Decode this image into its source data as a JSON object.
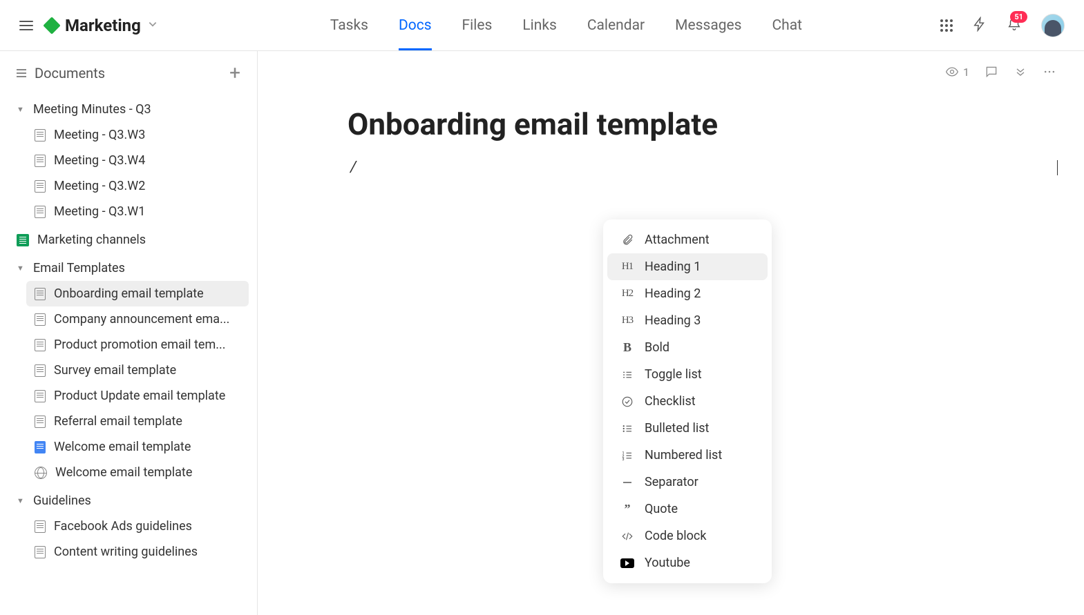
{
  "header": {
    "workspace_name": "Marketing",
    "tabs": [
      "Tasks",
      "Docs",
      "Files",
      "Links",
      "Calendar",
      "Messages",
      "Chat"
    ],
    "active_tab": 1,
    "notification_count": "51"
  },
  "sidebar": {
    "title": "Documents",
    "sections": [
      {
        "label": "Meeting Minutes - Q3",
        "expanded": true,
        "items": [
          {
            "label": "Meeting - Q3.W3",
            "type": "doc"
          },
          {
            "label": "Meeting - Q3.W4",
            "type": "doc"
          },
          {
            "label": "Meeting - Q3.W2",
            "type": "doc"
          },
          {
            "label": "Meeting - Q3.W1",
            "type": "doc"
          }
        ]
      },
      {
        "label": "Marketing channels",
        "expanded": false,
        "icon": "sheet"
      },
      {
        "label": "Email Templates",
        "expanded": true,
        "items": [
          {
            "label": "Onboarding email template",
            "type": "doc",
            "selected": true
          },
          {
            "label": "Company announcement ema...",
            "type": "doc"
          },
          {
            "label": "Product promotion email tem...",
            "type": "doc"
          },
          {
            "label": "Survey email template",
            "type": "doc"
          },
          {
            "label": "Product Update email template",
            "type": "doc"
          },
          {
            "label": "Referral email template",
            "type": "doc"
          },
          {
            "label": "Welcome email template",
            "type": "doc-blue"
          },
          {
            "label": "Welcome email template",
            "type": "globe"
          }
        ]
      },
      {
        "label": "Guidelines",
        "expanded": true,
        "items": [
          {
            "label": "Facebook Ads guidelines",
            "type": "doc"
          },
          {
            "label": "Content writing guidelines",
            "type": "doc"
          }
        ]
      }
    ]
  },
  "content": {
    "title": "Onboarding email template",
    "view_count": "1",
    "slash_text": "/"
  },
  "slash_menu": {
    "items": [
      {
        "icon": "attachment",
        "label": "Attachment"
      },
      {
        "icon": "h1",
        "label": "Heading 1",
        "highlighted": true
      },
      {
        "icon": "h2",
        "label": "Heading 2"
      },
      {
        "icon": "h3",
        "label": "Heading 3"
      },
      {
        "icon": "bold",
        "label": "Bold"
      },
      {
        "icon": "toggle",
        "label": "Toggle list"
      },
      {
        "icon": "checklist",
        "label": "Checklist"
      },
      {
        "icon": "bulleted",
        "label": "Bulleted list"
      },
      {
        "icon": "numbered",
        "label": "Numbered list"
      },
      {
        "icon": "separator",
        "label": "Separator"
      },
      {
        "icon": "quote",
        "label": "Quote"
      },
      {
        "icon": "code",
        "label": "Code block"
      },
      {
        "icon": "youtube",
        "label": "Youtube"
      }
    ]
  }
}
